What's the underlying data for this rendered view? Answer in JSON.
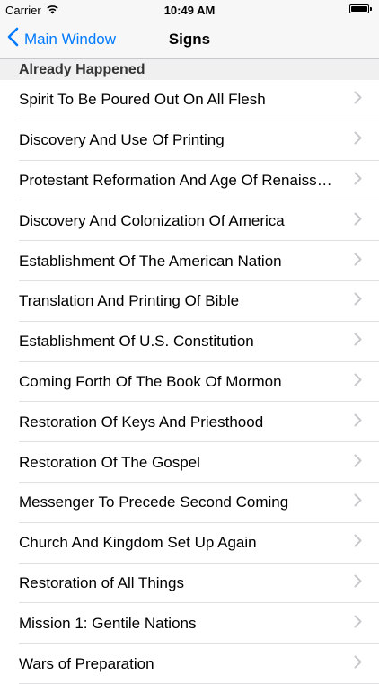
{
  "status": {
    "carrier": "Carrier",
    "time": "10:49 AM",
    "battery_level": 1.0
  },
  "nav": {
    "back_label": "Main Window",
    "title": "Signs",
    "back_icon": "chevron-left-icon",
    "accent_color": "#007aff"
  },
  "section": {
    "header": "Already Happened"
  },
  "rows": [
    "Spirit To Be Poured Out On All Flesh",
    "Discovery And Use Of Printing",
    "Protestant Reformation And Age Of Renaissance",
    "Discovery And Colonization Of America",
    "Establishment Of The American Nation",
    "Translation And Printing Of Bible",
    "Establishment Of U.S. Constitution",
    "Coming Forth Of The Book Of Mormon",
    "Restoration Of Keys And Priesthood",
    "Restoration Of The Gospel",
    "Messenger To Precede Second Coming",
    "Church And Kingdom Set Up Again",
    "Restoration of All Things",
    "Mission 1: Gentile Nations",
    "Wars of Preparation"
  ]
}
